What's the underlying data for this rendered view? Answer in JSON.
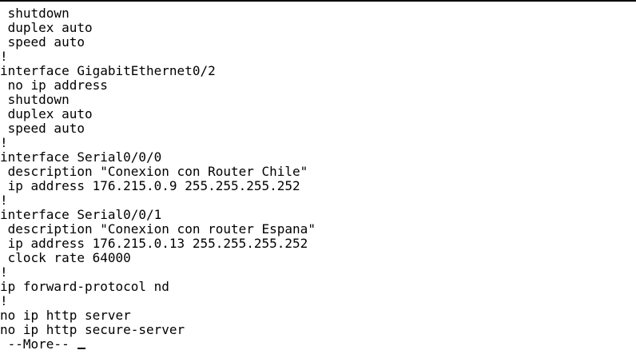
{
  "terminal": {
    "lines": [
      " shutdown",
      " duplex auto",
      " speed auto",
      "!",
      "interface GigabitEthernet0/2",
      " no ip address",
      " shutdown",
      " duplex auto",
      " speed auto",
      "!",
      "interface Serial0/0/0",
      " description \"Conexion con Router Chile\"",
      " ip address 176.215.0.9 255.255.255.252",
      "!",
      "interface Serial0/0/1",
      " description \"Conexion con router Espana\"",
      " ip address 176.215.0.13 255.255.255.252",
      " clock rate 64000",
      "!",
      "ip forward-protocol nd",
      "!",
      "no ip http server",
      "no ip http secure-server"
    ],
    "more_prompt": " --More-- "
  }
}
